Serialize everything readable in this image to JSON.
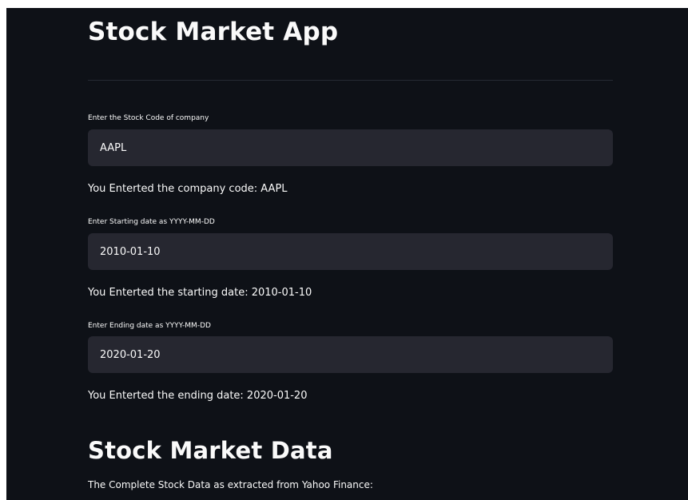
{
  "app": {
    "title": "Stock Market App"
  },
  "stock_code": {
    "label": "Enter the Stock Code of company",
    "value": "AAPL",
    "echo": "You Enterted the company code: AAPL"
  },
  "start_date": {
    "label": "Enter Starting date as YYYY-MM-DD",
    "value": "2010-01-10",
    "echo": "You Enterted the starting date: 2010-01-10"
  },
  "end_date": {
    "label": "Enter Ending date as YYYY-MM-DD",
    "value": "2020-01-20",
    "echo": "You Enterted the ending date: 2020-01-20"
  },
  "data_section": {
    "title": "Stock Market Data",
    "caption": "The Complete Stock Data as extracted from Yahoo Finance:"
  },
  "colors": {
    "background": "#0e1117",
    "input_background": "#262730",
    "text": "#fafafa"
  }
}
